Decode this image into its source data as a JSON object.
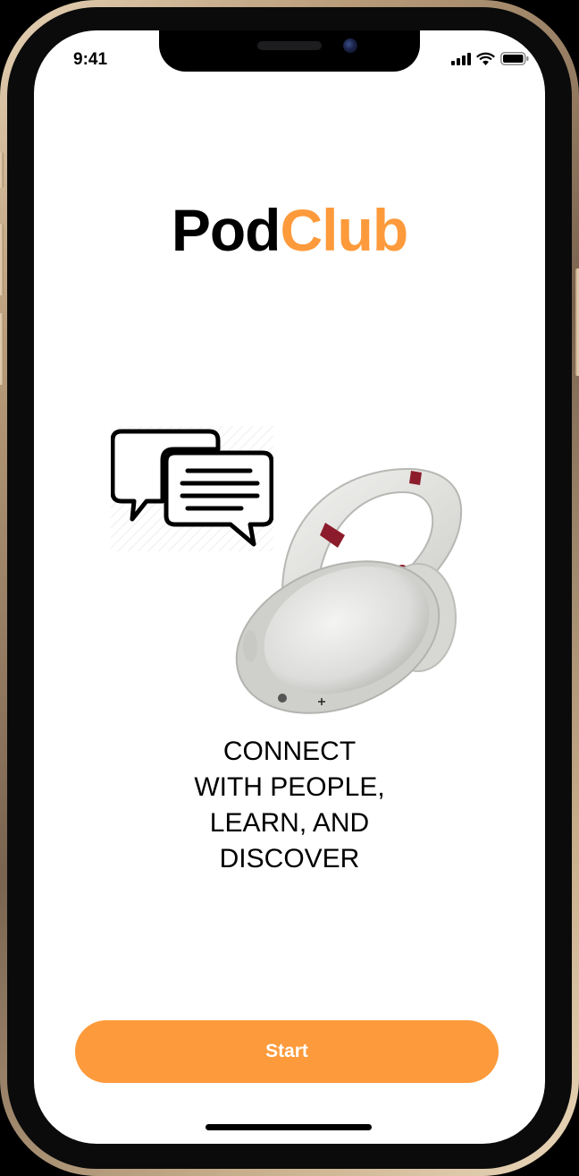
{
  "status_bar": {
    "time": "9:41",
    "icons": [
      "cellular-signal-icon",
      "wifi-icon",
      "battery-icon"
    ]
  },
  "logo": {
    "part1": "Pod",
    "part2": "Club",
    "part1_color": "#000000",
    "part2_color": "#fd9a3b"
  },
  "illustrations": [
    "chat-bubbles-icon",
    "headphones-image"
  ],
  "tagline": {
    "lines": [
      "CONNECT",
      "WITH PEOPLE,",
      "LEARN, AND",
      "DISCOVER"
    ]
  },
  "start_button": {
    "label": "Start",
    "color": "#fd9a3b"
  }
}
